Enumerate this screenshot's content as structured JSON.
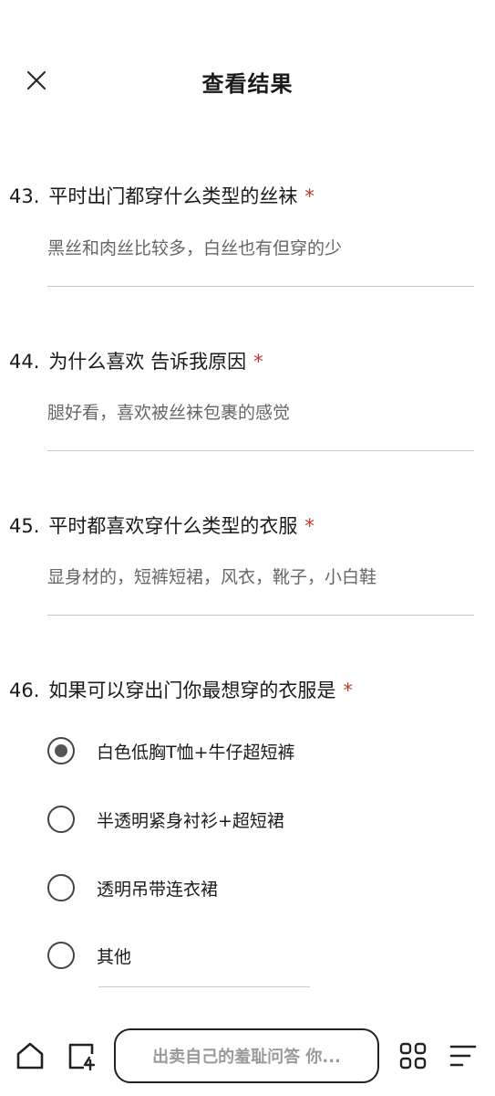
{
  "header": {
    "title": "查看结果"
  },
  "questions": [
    {
      "number": "43.",
      "text": "平时出门都穿什么类型的丝袜",
      "required_mark": "*",
      "answer": "黑丝和肉丝比较多，白丝也有但穿的少"
    },
    {
      "number": "44.",
      "text": "为什么喜欢 告诉我原因",
      "required_mark": "*",
      "answer": "腿好看，喜欢被丝袜包裹的感觉"
    },
    {
      "number": "45.",
      "text": "平时都喜欢穿什么类型的衣服",
      "required_mark": "*",
      "answer": "显身材的，短裤短裙，风衣，靴子，小白鞋"
    },
    {
      "number": "46.",
      "text": "如果可以穿出门你最想穿的衣服是",
      "required_mark": "*",
      "options": [
        {
          "label": "白色低胸T恤+牛仔超短裤",
          "checked": true
        },
        {
          "label": "半透明紧身衬衫+超短裙",
          "checked": false
        },
        {
          "label": "透明吊带连衣裙",
          "checked": false
        },
        {
          "label": "其他",
          "checked": false
        }
      ]
    }
  ],
  "bottom_bar": {
    "search_placeholder": "出卖自己的羞耻问答 你..."
  },
  "icons": {
    "close": "close-icon",
    "home": "home-icon",
    "tabs": "tabs-icon",
    "apps": "apps-grid-icon",
    "menu": "menu-icon"
  }
}
